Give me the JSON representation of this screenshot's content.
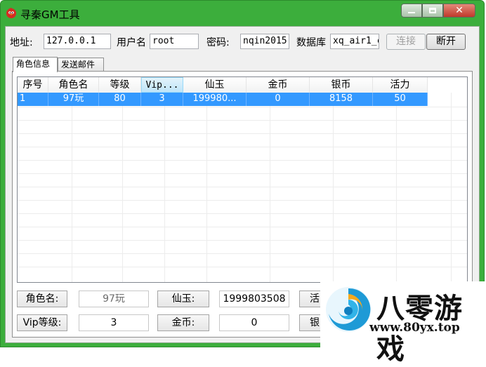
{
  "window": {
    "title": "寻秦GM工具"
  },
  "connection": {
    "address_label": "地址:",
    "address_value": "127.0.0.1",
    "user_label": "用户名",
    "user_value": "root",
    "password_label": "密码:",
    "password_value": "nqin2015",
    "database_label": "数据库",
    "database_value": "xq_air1_c",
    "connect_button": "连接",
    "disconnect_button": "断开"
  },
  "tabs": [
    {
      "label": "角色信息"
    },
    {
      "label": "发送邮件"
    }
  ],
  "grid": {
    "columns": [
      "序号",
      "角色名",
      "等级",
      "Vip...",
      "仙玉",
      "金币",
      "银币",
      "活力"
    ],
    "rows": [
      [
        "1",
        "97玩",
        "80",
        "3",
        "199980...",
        "0",
        "8158",
        "50"
      ]
    ]
  },
  "details": {
    "role_name_label": "角色名:",
    "role_name_value": "97玩",
    "xianyu_label": "仙玉:",
    "xianyu_value": "1999803508",
    "huoli_label_partial": "活",
    "vip_label": "Vip等级:",
    "vip_value": "3",
    "gold_label": "金币:",
    "gold_value": "0",
    "silver_label_partial": "银"
  },
  "watermark": {
    "brand": "八零游戏",
    "url": "www.80yx.top"
  },
  "colors": {
    "window_frame": "#3cae3c",
    "selection": "#3399ff",
    "close_button": "#c0392b"
  }
}
